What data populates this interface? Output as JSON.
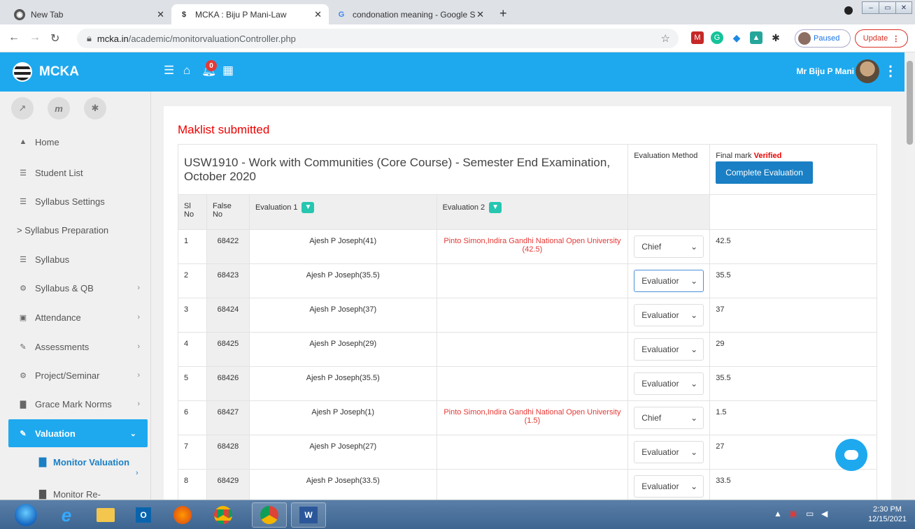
{
  "browser": {
    "tabs": [
      {
        "title": "New Tab"
      },
      {
        "title": "MCKA : Biju P Mani-Law"
      },
      {
        "title": "condonation meaning - Google S"
      }
    ],
    "url_host": "mcka.in",
    "url_path": "/academic/monitorvaluationController.php",
    "paused_label": "Paused",
    "update_label": "Update"
  },
  "app": {
    "brand": "MCKA",
    "notification_count": "0",
    "user_name": "Mr Biju P Mani"
  },
  "sidebar": {
    "items": [
      {
        "label": "Home"
      },
      {
        "label": "Student List"
      },
      {
        "label": "Syllabus Settings"
      },
      {
        "label": "> Syllabus Preparation"
      },
      {
        "label": "Syllabus"
      },
      {
        "label": "Syllabus & QB"
      },
      {
        "label": "Attendance"
      },
      {
        "label": "Assessments"
      },
      {
        "label": "Project/Seminar"
      },
      {
        "label": "Grace Mark Norms"
      },
      {
        "label": "Valuation"
      }
    ],
    "sub_items": [
      {
        "label": "Monitor Valuation"
      },
      {
        "label": "Monitor Re-"
      }
    ]
  },
  "main": {
    "status": "Maklist submitted",
    "course_title": "USW1910 - Work with Communities (Core Course) - Semester End Examination, October 2020",
    "eval_method_header": "Evaluation Method",
    "final_mark_label": "Final mark",
    "final_mark_status": "Verified",
    "complete_button": "Complete Evaluation",
    "columns": {
      "sl_no": "Sl No",
      "false_no": "False No",
      "eval1": "Evaluation 1",
      "eval2": "Evaluation 2"
    },
    "rows": [
      {
        "sl": "1",
        "false_no": "68422",
        "eval1": "Ajesh P Joseph(41)",
        "eval2": "Pinto Simon,Indira Gandhi National Open University (42.5)",
        "method": "Chief",
        "final": "42.5"
      },
      {
        "sl": "2",
        "false_no": "68423",
        "eval1": "Ajesh P Joseph(35.5)",
        "eval2": "",
        "method": "Evaluatior",
        "final": "35.5"
      },
      {
        "sl": "3",
        "false_no": "68424",
        "eval1": "Ajesh P Joseph(37)",
        "eval2": "",
        "method": "Evaluatior",
        "final": "37"
      },
      {
        "sl": "4",
        "false_no": "68425",
        "eval1": "Ajesh P Joseph(29)",
        "eval2": "",
        "method": "Evaluatior",
        "final": "29"
      },
      {
        "sl": "5",
        "false_no": "68426",
        "eval1": "Ajesh P Joseph(35.5)",
        "eval2": "",
        "method": "Evaluatior",
        "final": "35.5"
      },
      {
        "sl": "6",
        "false_no": "68427",
        "eval1": "Ajesh P Joseph(1)",
        "eval2": "Pinto Simon,Indira Gandhi National Open University (1.5)",
        "method": "Chief",
        "final": "1.5"
      },
      {
        "sl": "7",
        "false_no": "68428",
        "eval1": "Ajesh P Joseph(27)",
        "eval2": "",
        "method": "Evaluatior",
        "final": "27"
      },
      {
        "sl": "8",
        "false_no": "68429",
        "eval1": "Ajesh P Joseph(33.5)",
        "eval2": "",
        "method": "Evaluatior",
        "final": "33.5"
      }
    ]
  },
  "taskbar": {
    "time": "2:30 PM",
    "date": "12/15/2021"
  },
  "colors": {
    "accent": "#1ea9ef",
    "status_red": "#e53935",
    "button_blue": "#1a7fc4"
  }
}
